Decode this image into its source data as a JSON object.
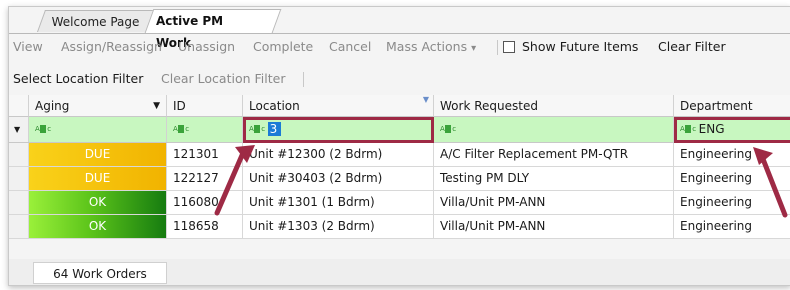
{
  "tabs": {
    "welcome": "Welcome Page",
    "active": "Active PM Work"
  },
  "toolbar": {
    "view": "View",
    "assign": "Assign/Reassign",
    "unassign": "Unassign",
    "complete": "Complete",
    "cancel": "Cancel",
    "mass_actions": "Mass Actions",
    "mass_actions_caret": "▾",
    "show_future": "Show Future Items",
    "clear_filter": "Clear Filter"
  },
  "location_toolbar": {
    "select": "Select Location Filter",
    "clear": "Clear Location Filter"
  },
  "grid": {
    "columns": {
      "aging": "Aging",
      "aging_sort": "▼",
      "id": "ID",
      "location": "Location",
      "work": "Work Requested",
      "department": "Department"
    },
    "filter_icon": "A▯c",
    "filter_row_indicator": "▼",
    "filters": {
      "location": "3",
      "department": "ENG"
    },
    "rows": [
      {
        "aging": "DUE",
        "status": "due",
        "id": "121301",
        "location": "Unit #12300 (2 Bdrm)",
        "work": "A/C Filter Replacement PM-QTR",
        "department": "Engineering"
      },
      {
        "aging": "DUE",
        "status": "due",
        "id": "122127",
        "location": "Unit #30403 (2 Bdrm)",
        "work": "Testing PM DLY",
        "department": "Engineering"
      },
      {
        "aging": "OK",
        "status": "ok",
        "id": "116080",
        "location": "Unit #1301 (1 Bdrm)",
        "work": "Villa/Unit PM-ANN",
        "department": "Engineering"
      },
      {
        "aging": "OK",
        "status": "ok",
        "id": "118658",
        "location": "Unit #1303 (2 Bdrm)",
        "work": "Villa/Unit PM-ANN",
        "department": "Engineering"
      }
    ]
  },
  "footer": {
    "count": "64 Work Orders"
  },
  "colors": {
    "filter_bg": "#c8f7c0",
    "highlight": "#9e2a45",
    "selection": "#1b7bd6",
    "due": "#f4c20d",
    "ok_light": "#9af03a",
    "ok_dark": "#167c10"
  }
}
